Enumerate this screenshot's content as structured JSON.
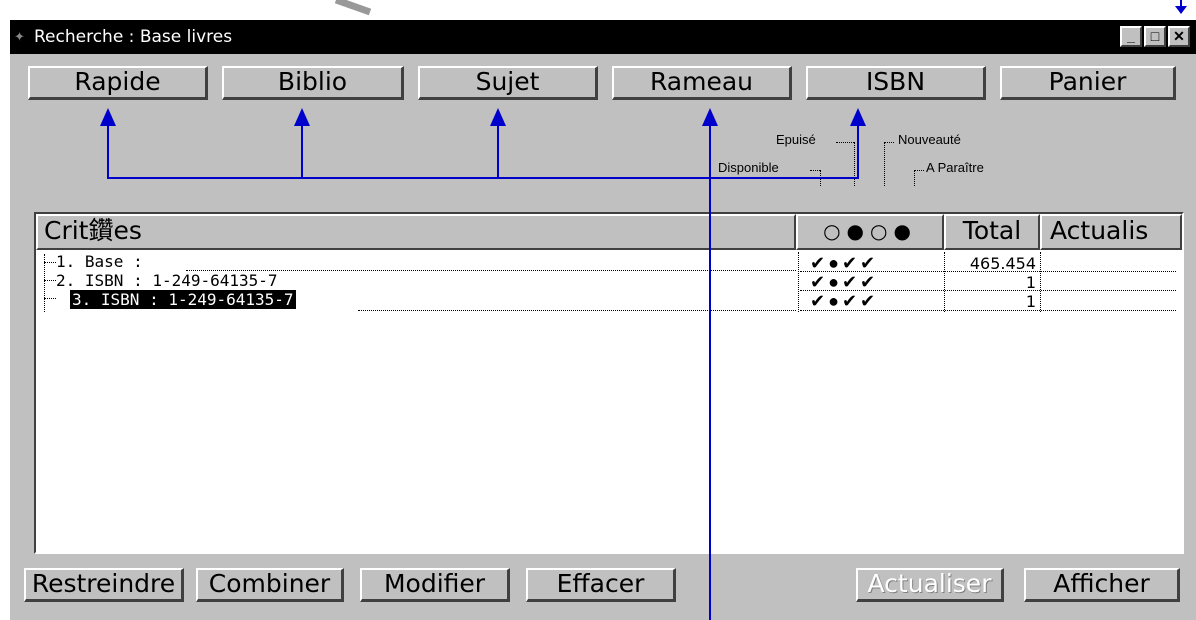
{
  "window": {
    "title": "Recherche : Base livres"
  },
  "title_buttons": {
    "minimize": "_",
    "maximize": "□",
    "close": "✕"
  },
  "top_buttons": [
    "Rapide",
    "Biblio",
    "Sujet",
    "Rameau",
    "ISBN",
    "Panier"
  ],
  "legend": {
    "epuise": "Epuisé",
    "disponible": "Disponible",
    "nouveaute": "Nouveauté",
    "a_paraitre": "A Paraître"
  },
  "columns": {
    "criteres": "Crit鑽es",
    "status_icons": "○●○●",
    "total": "Total",
    "actualis": "Actualis"
  },
  "rows": [
    {
      "label": "1. Base :",
      "status": "✔●✔✔",
      "total": "465.454",
      "actualis": ""
    },
    {
      "label": "2. ISBN :  1-249-64135-7",
      "status": "✔●✔✔",
      "total": "1",
      "actualis": ""
    },
    {
      "label": "3. ISBN :  1-249-64135-7",
      "status": "✔●✔✔",
      "total": "1",
      "actualis": "",
      "selected": true
    }
  ],
  "bottom_buttons": {
    "restreindre": "Restreindre",
    "combiner": "Combiner",
    "modifier": "Modifier",
    "effacer": "Effacer",
    "actualiser": "Actualiser",
    "afficher": "Afficher"
  },
  "colors": {
    "annotation": "#0000cc",
    "titlebar": "#000000",
    "face": "#c0c0c0"
  }
}
